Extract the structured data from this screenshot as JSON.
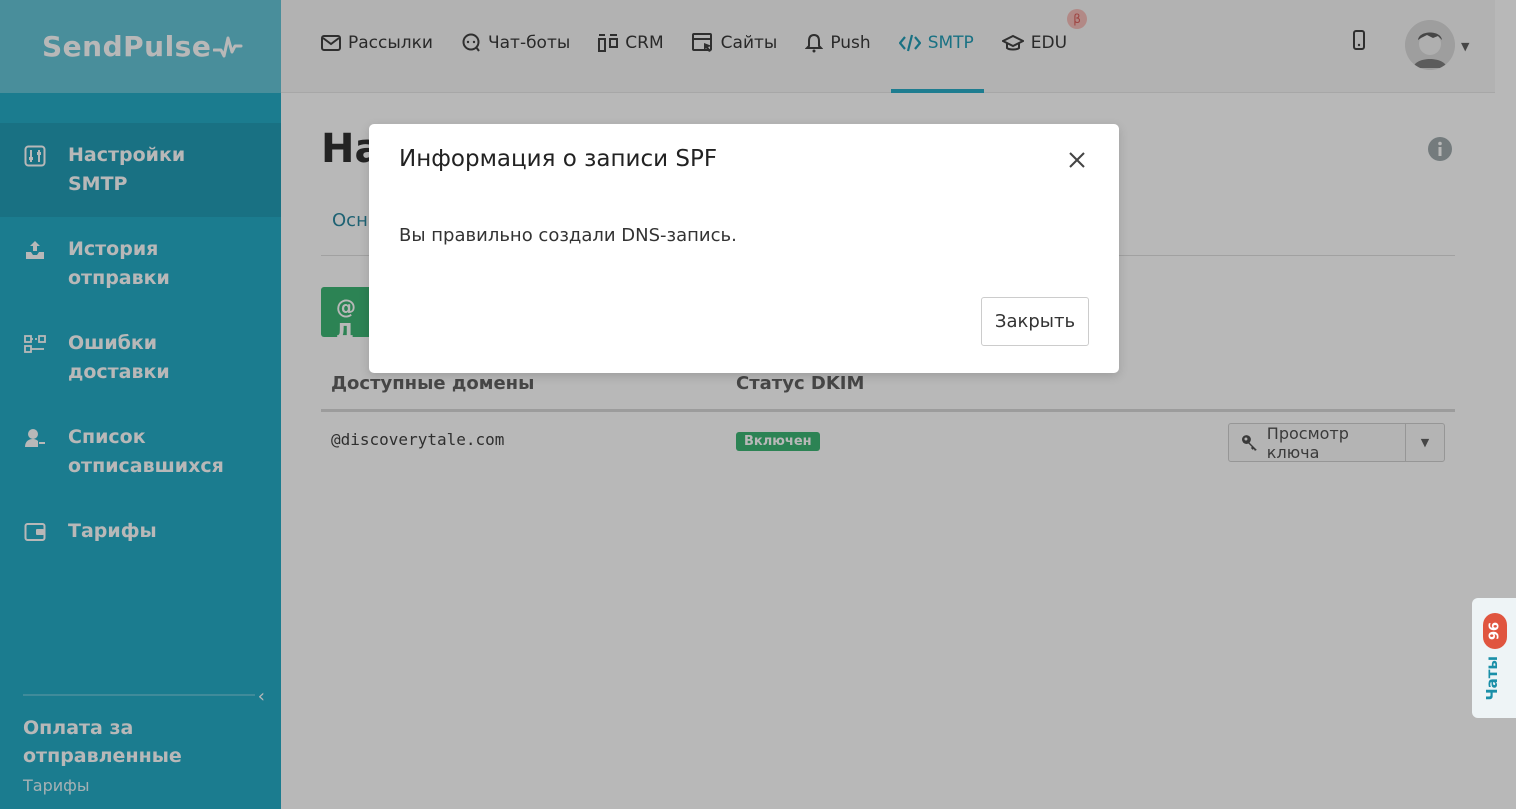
{
  "brand": {
    "name": "SendPulse"
  },
  "topnav": {
    "items": [
      {
        "label": "Рассылки",
        "icon": "envelope-icon"
      },
      {
        "label": "Чат-боты",
        "icon": "chat-bot-icon"
      },
      {
        "label": "CRM",
        "icon": "crm-icon"
      },
      {
        "label": "Сайты",
        "icon": "sites-icon"
      },
      {
        "label": "Push",
        "icon": "bell-icon"
      },
      {
        "label": "SMTP",
        "icon": "code-icon",
        "active": true
      },
      {
        "label": "EDU",
        "icon": "graduation-cap-icon",
        "badge": "β"
      }
    ]
  },
  "sidebar": {
    "items": [
      {
        "label": "Настройки SMTP",
        "icon": "settings-sliders-icon",
        "active": true
      },
      {
        "label": "История отправки",
        "icon": "upload-tray-icon"
      },
      {
        "label": "Ошибки доставки",
        "icon": "delivery-errors-icon"
      },
      {
        "label": "Список отписавшихся",
        "icon": "user-minus-icon"
      },
      {
        "label": "Тарифы",
        "icon": "wallet-icon"
      }
    ],
    "bottom": {
      "title": "Оплата за отправленные",
      "subtitle": "Тарифы"
    }
  },
  "main": {
    "title": "На",
    "tab_partial": "Осн",
    "add_button_partial": "@ Д",
    "table": {
      "headers": [
        "Доступные домены",
        "Статус DKIM"
      ],
      "rows": [
        {
          "domain": "@discoverytale.com",
          "status": "Включен",
          "action": "Просмотр ключа"
        }
      ]
    }
  },
  "chat_widget": {
    "label": "Чаты",
    "count": "96"
  },
  "modal": {
    "title": "Информация о записи SPF",
    "body": "Вы правильно создали DNS-запись.",
    "close_button": "Закрыть"
  },
  "colors": {
    "sidebar_bg": "#16a6c2",
    "accent": "#1aa7c3",
    "success": "#2fb06a",
    "badge_red": "#e0553f"
  }
}
